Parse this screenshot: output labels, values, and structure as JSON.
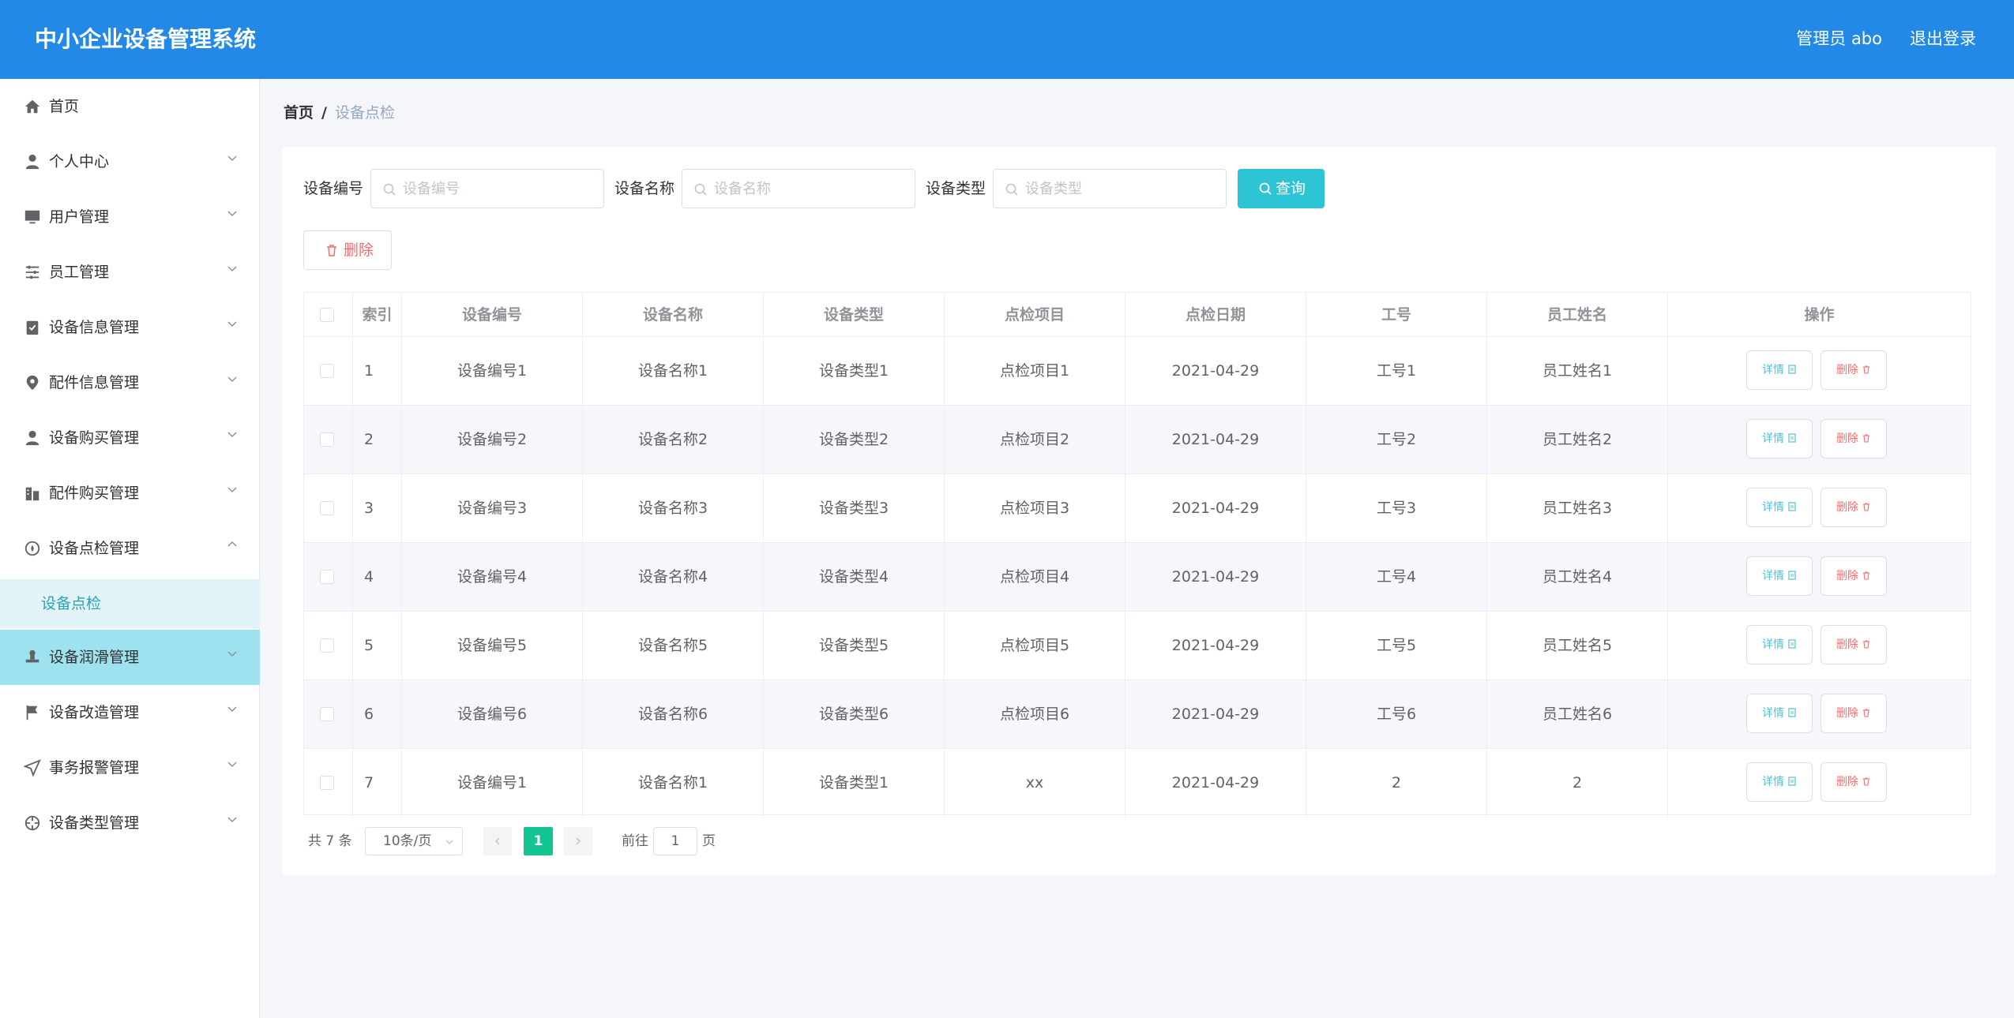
{
  "header": {
    "app_title": "中小企业设备管理系统",
    "user_info": "管理员 abo",
    "logout_label": "退出登录",
    "bg_color": "#2389e6"
  },
  "sidebar": {
    "items": [
      {
        "label": "首页",
        "icon": "home-icon"
      },
      {
        "label": "个人中心",
        "icon": "user-icon"
      },
      {
        "label": "用户管理",
        "icon": "monitor-icon"
      },
      {
        "label": "员工管理",
        "icon": "sliders-icon"
      },
      {
        "label": "设备信息管理",
        "icon": "clipboard-check-icon"
      },
      {
        "label": "配件信息管理",
        "icon": "map-pin-icon"
      },
      {
        "label": "设备购买管理",
        "icon": "user-icon"
      },
      {
        "label": "配件购买管理",
        "icon": "office-building-icon"
      },
      {
        "label": "设备点检管理",
        "icon": "compass-icon"
      },
      {
        "label": "设备润滑管理",
        "icon": "stamp-icon"
      },
      {
        "label": "设备改造管理",
        "icon": "flag-icon"
      },
      {
        "label": "事务报警管理",
        "icon": "paper-plane-icon"
      },
      {
        "label": "设备类型管理",
        "icon": "crosshair-icon"
      }
    ],
    "sub_items": [
      {
        "label": "设备点检",
        "parent": "设备点检管理"
      }
    ]
  },
  "breadcrumb": {
    "home": "首页",
    "separator": "/",
    "current": "设备点检"
  },
  "filters": {
    "device_no": {
      "label": "设备编号",
      "placeholder": "设备编号"
    },
    "device_name": {
      "label": "设备名称",
      "placeholder": "设备名称"
    },
    "device_type": {
      "label": "设备类型",
      "placeholder": "设备类型"
    },
    "query_label": "查询",
    "query_color": "#2dc5d6"
  },
  "toolbar": {
    "delete_label": "删除"
  },
  "table": {
    "columns": [
      "索引",
      "设备编号",
      "设备名称",
      "设备类型",
      "点检项目",
      "点检日期",
      "工号",
      "员工姓名",
      "操作"
    ],
    "rows": [
      {
        "index": "1",
        "device_no": "设备编号1",
        "device_name": "设备名称1",
        "device_type": "设备类型1",
        "item": "点检项目1",
        "date": "2021-04-29",
        "emp_no": "工号1",
        "emp_name": "员工姓名1"
      },
      {
        "index": "2",
        "device_no": "设备编号2",
        "device_name": "设备名称2",
        "device_type": "设备类型2",
        "item": "点检项目2",
        "date": "2021-04-29",
        "emp_no": "工号2",
        "emp_name": "员工姓名2"
      },
      {
        "index": "3",
        "device_no": "设备编号3",
        "device_name": "设备名称3",
        "device_type": "设备类型3",
        "item": "点检项目3",
        "date": "2021-04-29",
        "emp_no": "工号3",
        "emp_name": "员工姓名3"
      },
      {
        "index": "4",
        "device_no": "设备编号4",
        "device_name": "设备名称4",
        "device_type": "设备类型4",
        "item": "点检项目4",
        "date": "2021-04-29",
        "emp_no": "工号4",
        "emp_name": "员工姓名4"
      },
      {
        "index": "5",
        "device_no": "设备编号5",
        "device_name": "设备名称5",
        "device_type": "设备类型5",
        "item": "点检项目5",
        "date": "2021-04-29",
        "emp_no": "工号5",
        "emp_name": "员工姓名5"
      },
      {
        "index": "6",
        "device_no": "设备编号6",
        "device_name": "设备名称6",
        "device_type": "设备类型6",
        "item": "点检项目6",
        "date": "2021-04-29",
        "emp_no": "工号6",
        "emp_name": "员工姓名6"
      },
      {
        "index": "7",
        "device_no": "设备编号1",
        "device_name": "设备名称1",
        "device_type": "设备类型1",
        "item": "xx",
        "date": "2021-04-29",
        "emp_no": "2",
        "emp_name": "2"
      }
    ],
    "detail_label": "详情",
    "delete_label": "删除"
  },
  "pagination": {
    "total_text": "共 7 条",
    "page_size": "10条/页",
    "current_page": "1",
    "goto_label": "前往",
    "goto_value": "1",
    "page_suffix": "页"
  }
}
